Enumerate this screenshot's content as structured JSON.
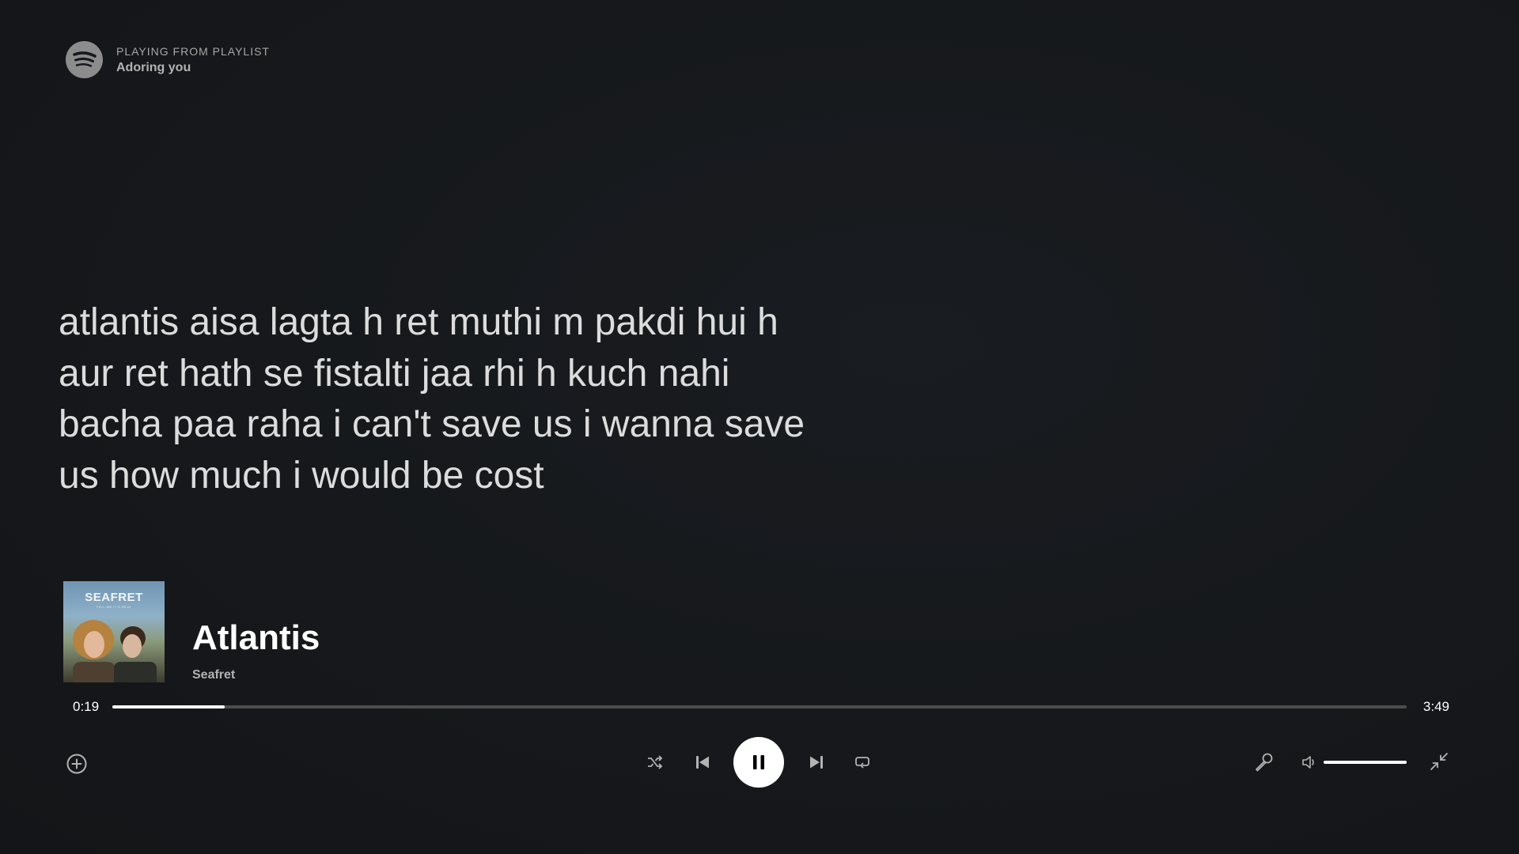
{
  "header": {
    "subtitle": "PLAYING FROM PLAYLIST",
    "playlist_name": "Adoring you",
    "logo_icon": "spotify-logo-icon"
  },
  "lyrics": {
    "lines": [
      "atlantis aisa lagta h ret muthi m pakdi hui h",
      "aur ret hath se fistalti jaa rhi h kuch nahi",
      "bacha paa raha i can't save us i wanna save",
      "us how much i would be cost"
    ]
  },
  "track": {
    "title": "Atlantis",
    "artist": "Seafret",
    "cover_text": "SEAFRET",
    "cover_subtext": "TELL ME IT'S REAL"
  },
  "progress": {
    "elapsed": "0:19",
    "duration": "3:49",
    "fraction": 0.087
  },
  "volume": {
    "fraction": 1.0
  },
  "controls": {
    "add_icon": "add-circle-icon",
    "shuffle_icon": "shuffle-icon",
    "previous_icon": "skip-previous-icon",
    "pause_icon": "pause-icon",
    "next_icon": "skip-next-icon",
    "repeat_icon": "repeat-icon",
    "lyrics_icon": "microphone-icon",
    "volume_icon": "volume-icon",
    "exit_fullscreen_icon": "exit-fullscreen-icon"
  },
  "colors": {
    "background": "#16181c",
    "accent": "#ffffff",
    "muted_text": "#b3b3b3",
    "track_background": "#4d4d4d"
  }
}
